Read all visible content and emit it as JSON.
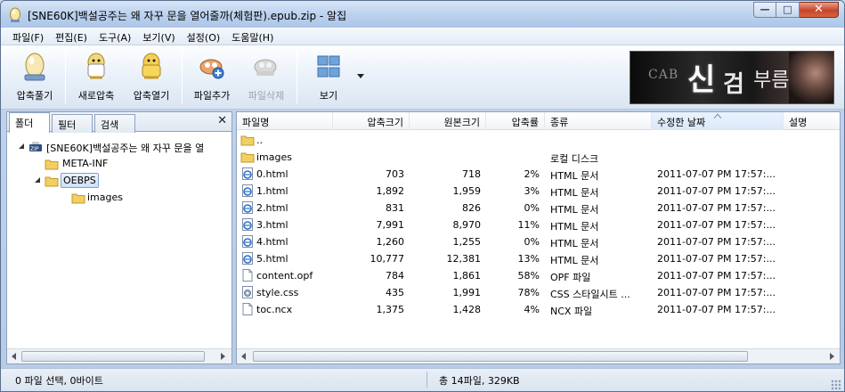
{
  "window": {
    "title": "[SNE60K]백설공주는 왜 자꾸 문을 열어줄까(체험판).epub.zip - 알집",
    "minimize": "—",
    "maximize": "□",
    "close": "✕"
  },
  "menu": [
    "파일(F)",
    "편집(E)",
    "도구(A)",
    "보기(V)",
    "설정(O)",
    "도움말(H)"
  ],
  "toolbar": {
    "buttons": [
      {
        "label": "압축풀기",
        "icon": "egg-icon",
        "enabled": true
      },
      {
        "label": "새로압축",
        "icon": "new-compress-icon",
        "enabled": true
      },
      {
        "label": "압축열기",
        "icon": "open-archive-icon",
        "enabled": true
      },
      {
        "label": "파일추가",
        "icon": "add-file-icon",
        "enabled": true
      },
      {
        "label": "파일삭제",
        "icon": "delete-file-icon",
        "enabled": false
      },
      {
        "label": "보기",
        "icon": "view-icon",
        "enabled": true
      }
    ],
    "banner": {
      "small": "CAB",
      "big": "신",
      "mid": "검",
      "tail": "부름"
    }
  },
  "left_pane": {
    "tabs": [
      "폴더",
      "필터",
      "검색"
    ],
    "close": "✕",
    "tree": [
      {
        "label": "[SNE60K]백설공주는 왜 자꾸 문을 열",
        "icon": "zip-archive-icon",
        "depth": 0,
        "expanded": true
      },
      {
        "label": "META-INF",
        "icon": "folder-icon",
        "depth": 1,
        "expanded": false
      },
      {
        "label": "OEBPS",
        "icon": "folder-icon",
        "depth": 1,
        "expanded": true,
        "selected": true
      },
      {
        "label": "images",
        "icon": "folder-icon",
        "depth": 2,
        "expanded": false
      }
    ]
  },
  "file_list": {
    "columns": [
      "파일명",
      "압축크기",
      "원본크기",
      "압축률",
      "종류",
      "수정한 날짜",
      "설명"
    ],
    "rows": [
      {
        "name": "..",
        "icon": "folder-icon",
        "packed": "",
        "original": "",
        "ratio": "",
        "type": "",
        "modified": ""
      },
      {
        "name": "images",
        "icon": "folder-icon",
        "packed": "",
        "original": "",
        "ratio": "",
        "type": "로컬 디스크",
        "modified": ""
      },
      {
        "name": "0.html",
        "icon": "html-file-icon",
        "packed": "703",
        "original": "718",
        "ratio": "2%",
        "type": "HTML 문서",
        "modified": "2011-07-07 PM 17:57:..."
      },
      {
        "name": "1.html",
        "icon": "html-file-icon",
        "packed": "1,892",
        "original": "1,959",
        "ratio": "3%",
        "type": "HTML 문서",
        "modified": "2011-07-07 PM 17:57:..."
      },
      {
        "name": "2.html",
        "icon": "html-file-icon",
        "packed": "831",
        "original": "826",
        "ratio": "0%",
        "type": "HTML 문서",
        "modified": "2011-07-07 PM 17:57:..."
      },
      {
        "name": "3.html",
        "icon": "html-file-icon",
        "packed": "7,991",
        "original": "8,970",
        "ratio": "11%",
        "type": "HTML 문서",
        "modified": "2011-07-07 PM 17:57:..."
      },
      {
        "name": "4.html",
        "icon": "html-file-icon",
        "packed": "1,260",
        "original": "1,255",
        "ratio": "0%",
        "type": "HTML 문서",
        "modified": "2011-07-07 PM 17:57:..."
      },
      {
        "name": "5.html",
        "icon": "html-file-icon",
        "packed": "10,777",
        "original": "12,381",
        "ratio": "13%",
        "type": "HTML 문서",
        "modified": "2011-07-07 PM 17:57:..."
      },
      {
        "name": "content.opf",
        "icon": "blank-file-icon",
        "packed": "784",
        "original": "1,861",
        "ratio": "58%",
        "type": "OPF 파일",
        "modified": "2011-07-07 PM 17:57:..."
      },
      {
        "name": "style.css",
        "icon": "css-file-icon",
        "packed": "435",
        "original": "1,991",
        "ratio": "78%",
        "type": "CSS 스타일시트 ...",
        "modified": "2011-07-07 PM 17:57:..."
      },
      {
        "name": "toc.ncx",
        "icon": "blank-file-icon",
        "packed": "1,375",
        "original": "1,428",
        "ratio": "4%",
        "type": "NCX 파일",
        "modified": "2011-07-07 PM 17:57:..."
      }
    ]
  },
  "status": {
    "left": "0 파일 선택,  0바이트",
    "right": "총 14파일,  329KB"
  }
}
